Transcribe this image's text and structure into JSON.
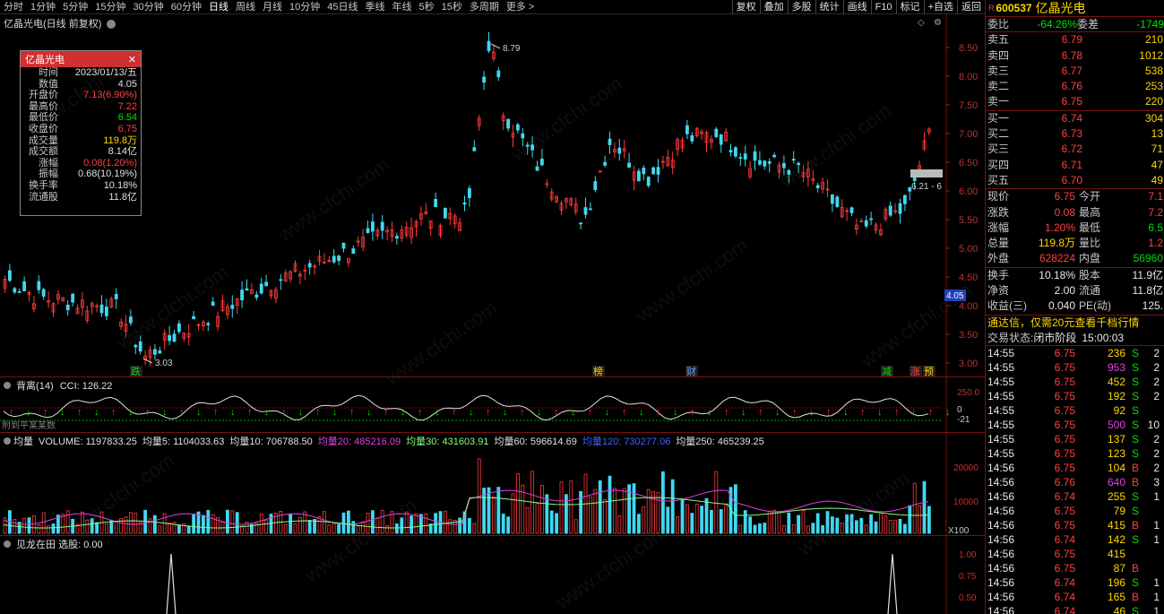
{
  "toolbar": {
    "periods": [
      "分时",
      "1分钟",
      "5分钟",
      "15分钟",
      "30分钟",
      "60分钟",
      "日线",
      "周线",
      "月线",
      "10分钟",
      "45日线",
      "季线",
      "年线",
      "5秒",
      "15秒",
      "多周期",
      "更多 >"
    ],
    "active_period": "日线",
    "tools": [
      "复权",
      "叠加",
      "多股",
      "统计",
      "画线",
      "F10",
      "标记",
      "+自选",
      "返回"
    ]
  },
  "main": {
    "title": "亿晶光电(日线 前复权)",
    "price_axis": [
      "8.50",
      "8.00",
      "7.50",
      "7.00",
      "6.50",
      "6.00",
      "5.50",
      "5.00",
      "4.50",
      "4.00",
      "3.50",
      "3.00"
    ],
    "high_label": "8.79",
    "low_label": "3.03",
    "range_label": "6.21 - 6",
    "current_marker": "4.05",
    "event_marks": [
      "跌",
      "榜",
      "财",
      "减",
      "涨",
      "预"
    ]
  },
  "info_box": {
    "title": "亿晶光电",
    "rows": [
      {
        "k": "时间",
        "v": "2023/01/13/五",
        "c": "white"
      },
      {
        "k": "数值",
        "v": "4.05",
        "c": "white"
      },
      {
        "k": "开盘价",
        "v": "7.13(6.90%)",
        "c": "red"
      },
      {
        "k": "最高价",
        "v": "7.22",
        "c": "red"
      },
      {
        "k": "最低价",
        "v": "6.54",
        "c": "green"
      },
      {
        "k": "收盘价",
        "v": "6.75",
        "c": "red"
      },
      {
        "k": "成交量",
        "v": "119.8万",
        "c": "yellow"
      },
      {
        "k": "成交额",
        "v": "8.14亿",
        "c": "white"
      },
      {
        "k": "涨幅",
        "v": "0.08(1.20%)",
        "c": "red"
      },
      {
        "k": "振幅",
        "v": "0.68(10.19%)",
        "c": "white"
      },
      {
        "k": "换手率",
        "v": "10.18%",
        "c": "white"
      },
      {
        "k": "流通股",
        "v": "11.8亿",
        "c": "white"
      }
    ]
  },
  "cci": {
    "head_a": "背离(14)",
    "head_b": "CCI: 126.22",
    "axis": [
      "250.0",
      "0",
      "-21"
    ],
    "note": "附到平某某数"
  },
  "volume": {
    "labels": [
      {
        "t": "均量",
        "c": "#e0e0e0"
      },
      {
        "t": "VOLUME: 1197833.25",
        "c": "#e0e0e0"
      },
      {
        "t": "均量5: 1104033.63",
        "c": "#e0e0e0"
      },
      {
        "t": "均量10: 706788.50",
        "c": "#e0e0e0"
      },
      {
        "t": "均量20: 485216.09",
        "c": "#e040e0"
      },
      {
        "t": "均量30: 431603.91",
        "c": "#80ff80"
      },
      {
        "t": "均量60: 596614.69",
        "c": "#e0e0e0"
      },
      {
        "t": "均量120: 730277.06",
        "c": "#4060ff"
      },
      {
        "t": "均量250: 465239.25",
        "c": "#e0e0e0"
      }
    ],
    "axis": [
      "20000",
      "10000"
    ],
    "unit": "X100"
  },
  "jl": {
    "head": "见龙在田 选股: 0.00",
    "axis": [
      "1.00",
      "0.75",
      "0.50"
    ]
  },
  "quote": {
    "badge": "R",
    "code": "600537",
    "name": "亿晶光电",
    "weibi_label": "委比",
    "weibi": "-64.26%",
    "weicha_label": "委差",
    "weicha": "-1749",
    "asks": [
      {
        "l": "卖五",
        "p": "6.79",
        "v": "210"
      },
      {
        "l": "卖四",
        "p": "6.78",
        "v": "1012"
      },
      {
        "l": "卖三",
        "p": "6.77",
        "v": "538"
      },
      {
        "l": "卖二",
        "p": "6.76",
        "v": "253"
      },
      {
        "l": "卖一",
        "p": "6.75",
        "v": "220"
      }
    ],
    "bids": [
      {
        "l": "买一",
        "p": "6.74",
        "v": "304"
      },
      {
        "l": "买二",
        "p": "6.73",
        "v": "13"
      },
      {
        "l": "买三",
        "p": "6.72",
        "v": "71"
      },
      {
        "l": "买四",
        "p": "6.71",
        "v": "47"
      },
      {
        "l": "买五",
        "p": "6.70",
        "v": "49"
      }
    ],
    "stats": [
      {
        "a": "现价",
        "av": "6.75",
        "ac": "red",
        "b": "今开",
        "bv": "7.1",
        "bc": "red"
      },
      {
        "a": "涨跌",
        "av": "0.08",
        "ac": "red",
        "b": "最高",
        "bv": "7.2",
        "bc": "red"
      },
      {
        "a": "涨幅",
        "av": "1.20%",
        "ac": "red",
        "b": "最低",
        "bv": "6.5",
        "bc": "green"
      },
      {
        "a": "总量",
        "av": "119.8万",
        "ac": "yellow",
        "b": "量比",
        "bv": "1.2",
        "bc": "red"
      },
      {
        "a": "外盘",
        "av": "628224",
        "ac": "red",
        "b": "内盘",
        "bv": "56960",
        "bc": "green"
      }
    ],
    "stats2": [
      {
        "a": "换手",
        "av": "10.18%",
        "ac": "white",
        "b": "股本",
        "bv": "11.9亿",
        "bc": "white"
      },
      {
        "a": "净资",
        "av": "2.00",
        "ac": "white",
        "b": "流通",
        "bv": "11.8亿",
        "bc": "white"
      },
      {
        "a": "收益(三)",
        "av": "0.040",
        "ac": "white",
        "b": "PE(动)",
        "bv": "125.",
        "bc": "white"
      }
    ],
    "promo": "通达信，仅需20元查看千档行情",
    "status_label": "交易状态:",
    "status": "闭市阶段",
    "status_time": "15:00:03",
    "ticks": [
      {
        "t": "14:55",
        "p": "6.75",
        "pc": "red",
        "v": "236",
        "vc": "yellow",
        "d": "S",
        "n": "2"
      },
      {
        "t": "14:55",
        "p": "6.75",
        "pc": "red",
        "v": "953",
        "vc": "purple",
        "d": "S",
        "n": "2"
      },
      {
        "t": "14:55",
        "p": "6.75",
        "pc": "red",
        "v": "452",
        "vc": "yellow",
        "d": "S",
        "n": "2"
      },
      {
        "t": "14:55",
        "p": "6.75",
        "pc": "red",
        "v": "192",
        "vc": "yellow",
        "d": "S",
        "n": "2"
      },
      {
        "t": "14:55",
        "p": "6.75",
        "pc": "red",
        "v": "92",
        "vc": "yellow",
        "d": "S",
        "n": ""
      },
      {
        "t": "14:55",
        "p": "6.75",
        "pc": "red",
        "v": "500",
        "vc": "purple",
        "d": "S",
        "n": "10"
      },
      {
        "t": "14:55",
        "p": "6.75",
        "pc": "red",
        "v": "137",
        "vc": "yellow",
        "d": "S",
        "n": "2"
      },
      {
        "t": "14:55",
        "p": "6.75",
        "pc": "red",
        "v": "123",
        "vc": "yellow",
        "d": "S",
        "n": "2"
      },
      {
        "t": "14:56",
        "p": "6.75",
        "pc": "red",
        "v": "104",
        "vc": "yellow",
        "d": "B",
        "n": "2"
      },
      {
        "t": "14:56",
        "p": "6.76",
        "pc": "red",
        "v": "640",
        "vc": "purple",
        "d": "B",
        "n": "3"
      },
      {
        "t": "14:56",
        "p": "6.74",
        "pc": "red",
        "v": "255",
        "vc": "yellow",
        "d": "S",
        "n": "1"
      },
      {
        "t": "14:56",
        "p": "6.75",
        "pc": "red",
        "v": "79",
        "vc": "yellow",
        "d": "S",
        "n": ""
      },
      {
        "t": "14:56",
        "p": "6.75",
        "pc": "red",
        "v": "415",
        "vc": "yellow",
        "d": "B",
        "n": "1"
      },
      {
        "t": "14:56",
        "p": "6.74",
        "pc": "red",
        "v": "142",
        "vc": "yellow",
        "d": "S",
        "n": "1"
      },
      {
        "t": "14:56",
        "p": "6.75",
        "pc": "red",
        "v": "415",
        "vc": "yellow",
        "d": "",
        "n": ""
      },
      {
        "t": "14:56",
        "p": "6.75",
        "pc": "red",
        "v": "87",
        "vc": "yellow",
        "d": "B",
        "n": ""
      },
      {
        "t": "14:56",
        "p": "6.74",
        "pc": "red",
        "v": "196",
        "vc": "yellow",
        "d": "S",
        "n": "1"
      },
      {
        "t": "14:56",
        "p": "6.74",
        "pc": "red",
        "v": "165",
        "vc": "yellow",
        "d": "B",
        "n": "1"
      },
      {
        "t": "14:56",
        "p": "6.74",
        "pc": "red",
        "v": "46",
        "vc": "yellow",
        "d": "S",
        "n": "1"
      }
    ]
  },
  "watermark": "www.cfchi.com"
}
